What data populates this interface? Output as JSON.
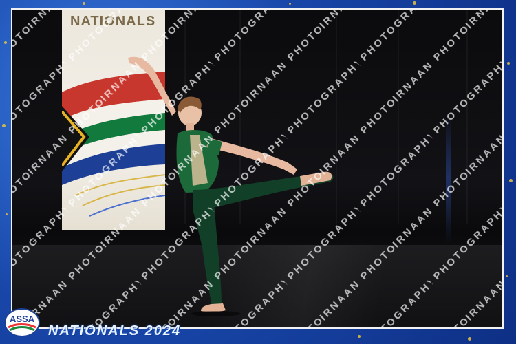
{
  "banner": {
    "title": "NATIONALS"
  },
  "watermark": {
    "text": "IRNAAN PHOTOGRAPHY"
  },
  "logo": {
    "text": "ASSA"
  },
  "footer": {
    "text": "NATIONALS 2024"
  },
  "colors": {
    "frame_blue": "#1846a8",
    "glitter_gold": "#e8c440",
    "costume_green": "#1c6a3a",
    "tights_green": "#123f27"
  }
}
